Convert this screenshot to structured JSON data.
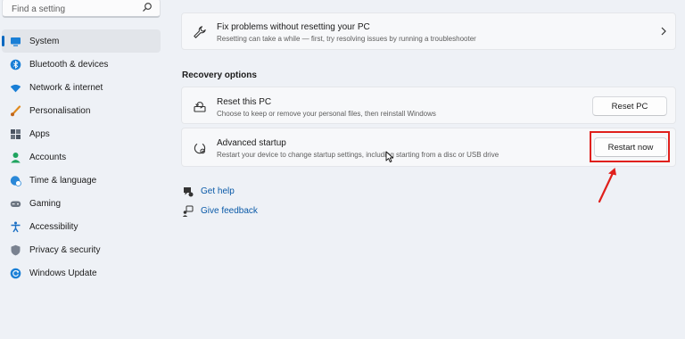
{
  "search": {
    "placeholder": "Find a setting",
    "icon": "search-icon"
  },
  "sidebar": {
    "items": [
      {
        "label": "System",
        "icon": "system-icon",
        "active": true
      },
      {
        "label": "Bluetooth & devices",
        "icon": "bluetooth-icon"
      },
      {
        "label": "Network & internet",
        "icon": "wifi-icon"
      },
      {
        "label": "Personalisation",
        "icon": "brush-icon"
      },
      {
        "label": "Apps",
        "icon": "apps-icon"
      },
      {
        "label": "Accounts",
        "icon": "person-icon"
      },
      {
        "label": "Time & language",
        "icon": "globe-clock-icon"
      },
      {
        "label": "Gaming",
        "icon": "gamepad-icon"
      },
      {
        "label": "Accessibility",
        "icon": "accessibility-icon"
      },
      {
        "label": "Privacy & security",
        "icon": "shield-icon"
      },
      {
        "label": "Windows Update",
        "icon": "update-icon"
      }
    ]
  },
  "main": {
    "fix_card": {
      "title": "Fix problems without resetting your PC",
      "subtitle": "Resetting can take a while — first, try resolving issues by running a troubleshooter",
      "icon": "wrench-icon"
    },
    "section_title": "Recovery options",
    "reset_card": {
      "title": "Reset this PC",
      "subtitle": "Choose to keep or remove your personal files, then reinstall Windows",
      "button": "Reset PC",
      "icon": "reset-pc-icon"
    },
    "advanced_card": {
      "title": "Advanced startup",
      "subtitle": "Restart your device to change startup settings, including starting from a disc or USB drive",
      "button": "Restart now",
      "icon": "advanced-startup-icon"
    },
    "links": [
      {
        "label": "Get help",
        "icon": "help-icon"
      },
      {
        "label": "Give feedback",
        "icon": "feedback-icon"
      }
    ]
  },
  "colors": {
    "accent": "#0067c0",
    "highlight": "#e0201c",
    "link": "#0a5aa8"
  }
}
